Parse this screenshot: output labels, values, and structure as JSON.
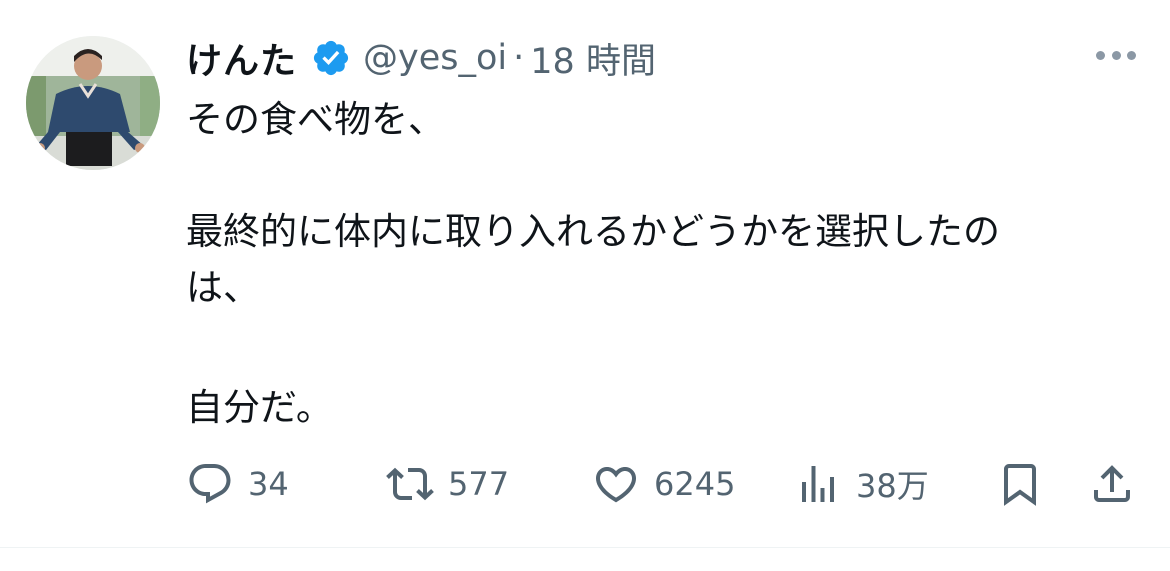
{
  "author": {
    "name": "けんた",
    "handle": "@yes_oi",
    "separator": "·",
    "time": "18 時間",
    "verified": true
  },
  "tweet": {
    "lines": [
      "その食べ物を、",
      "最終的に体内に取り入れるかどうかを選択したの",
      "は、",
      "自分だ。"
    ]
  },
  "actions": {
    "replies": "34",
    "retweets": "577",
    "likes": "6245",
    "views": "38万"
  },
  "colors": {
    "text": "#0f1419",
    "secondary": "#536471",
    "verified": "#1d9bf0",
    "divider": "#eff3f4"
  },
  "icons": [
    "more-icon",
    "verified-badge-icon",
    "reply-icon",
    "retweet-icon",
    "like-icon",
    "views-icon",
    "bookmark-icon",
    "share-icon"
  ]
}
